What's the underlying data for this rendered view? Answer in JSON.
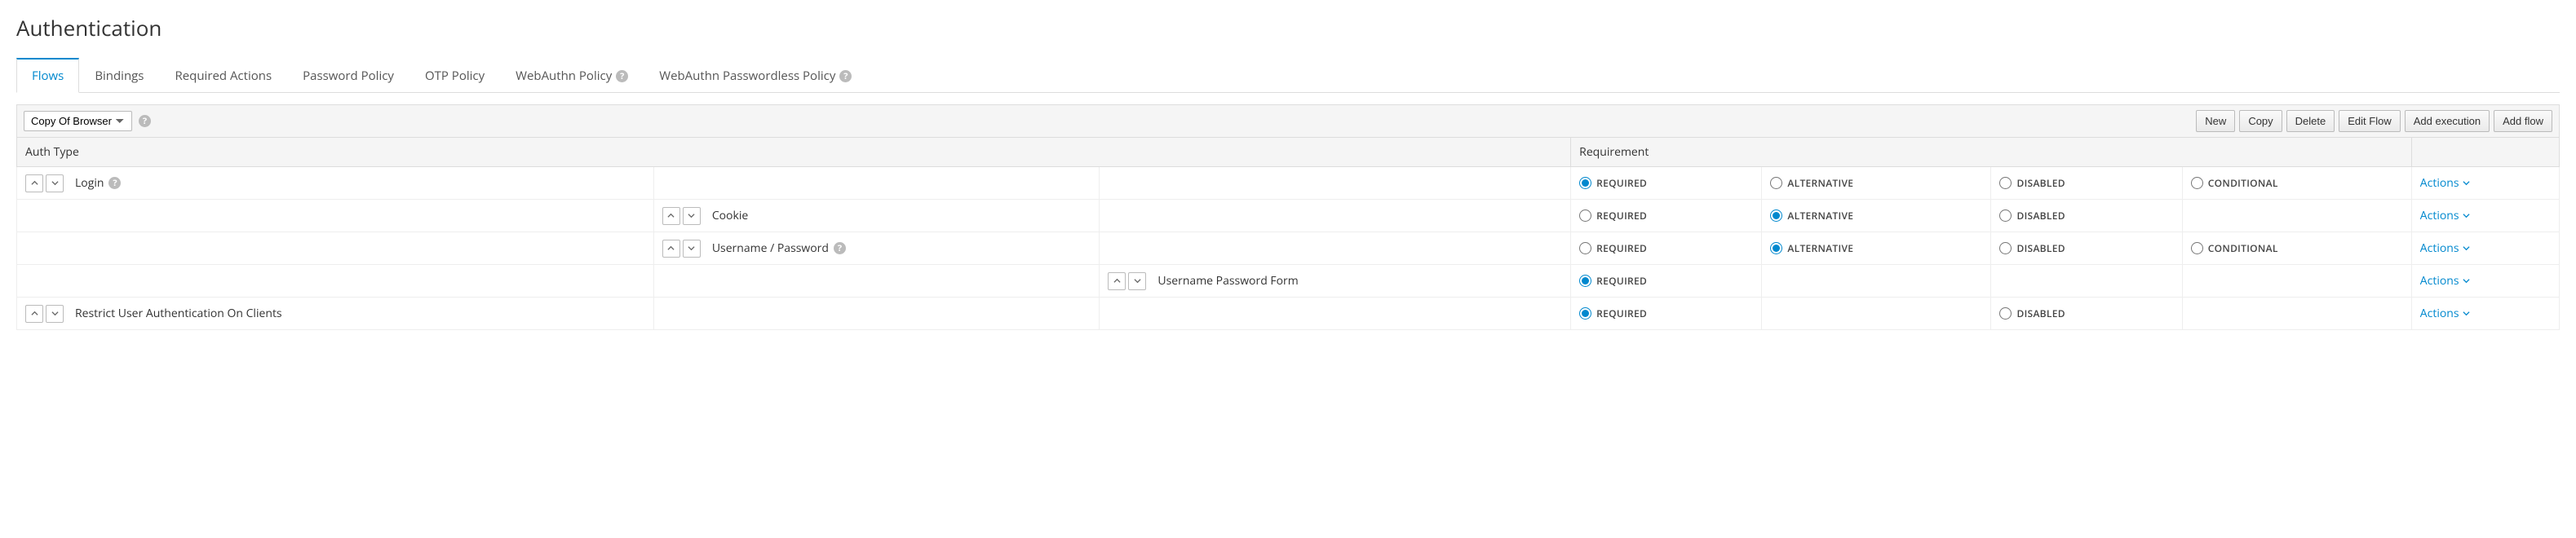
{
  "page_title": "Authentication",
  "tabs": [
    {
      "label": "Flows",
      "active": true,
      "help": false
    },
    {
      "label": "Bindings",
      "active": false,
      "help": false
    },
    {
      "label": "Required Actions",
      "active": false,
      "help": false
    },
    {
      "label": "Password Policy",
      "active": false,
      "help": false
    },
    {
      "label": "OTP Policy",
      "active": false,
      "help": false
    },
    {
      "label": "WebAuthn Policy",
      "active": false,
      "help": true
    },
    {
      "label": "WebAuthn Passwordless Policy",
      "active": false,
      "help": true
    }
  ],
  "flow_select": {
    "value": "Copy Of Browser"
  },
  "toolbar_buttons": [
    "New",
    "Copy",
    "Delete",
    "Edit Flow",
    "Add execution",
    "Add flow"
  ],
  "table": {
    "headers": {
      "auth_type": "Auth Type",
      "requirement": "Requirement"
    },
    "actions_label": "Actions",
    "requirement_labels": {
      "required": "REQUIRED",
      "alternative": "ALTERNATIVE",
      "disabled": "DISABLED",
      "conditional": "CONDITIONAL"
    },
    "rows": [
      {
        "level": 0,
        "name": "Login",
        "help": true,
        "options": [
          "required",
          "alternative",
          "disabled",
          "conditional"
        ],
        "selected": "required"
      },
      {
        "level": 1,
        "name": "Cookie",
        "help": false,
        "options": [
          "required",
          "alternative",
          "disabled"
        ],
        "selected": "alternative"
      },
      {
        "level": 1,
        "name": "Username / Password",
        "help": true,
        "options": [
          "required",
          "alternative",
          "disabled",
          "conditional"
        ],
        "selected": "alternative"
      },
      {
        "level": 2,
        "name": "Username Password Form",
        "help": false,
        "options": [
          "required"
        ],
        "selected": "required"
      },
      {
        "level": 0,
        "name": "Restrict User Authentication On Clients",
        "help": false,
        "options": [
          "required",
          "disabled"
        ],
        "selected": "required"
      }
    ]
  }
}
